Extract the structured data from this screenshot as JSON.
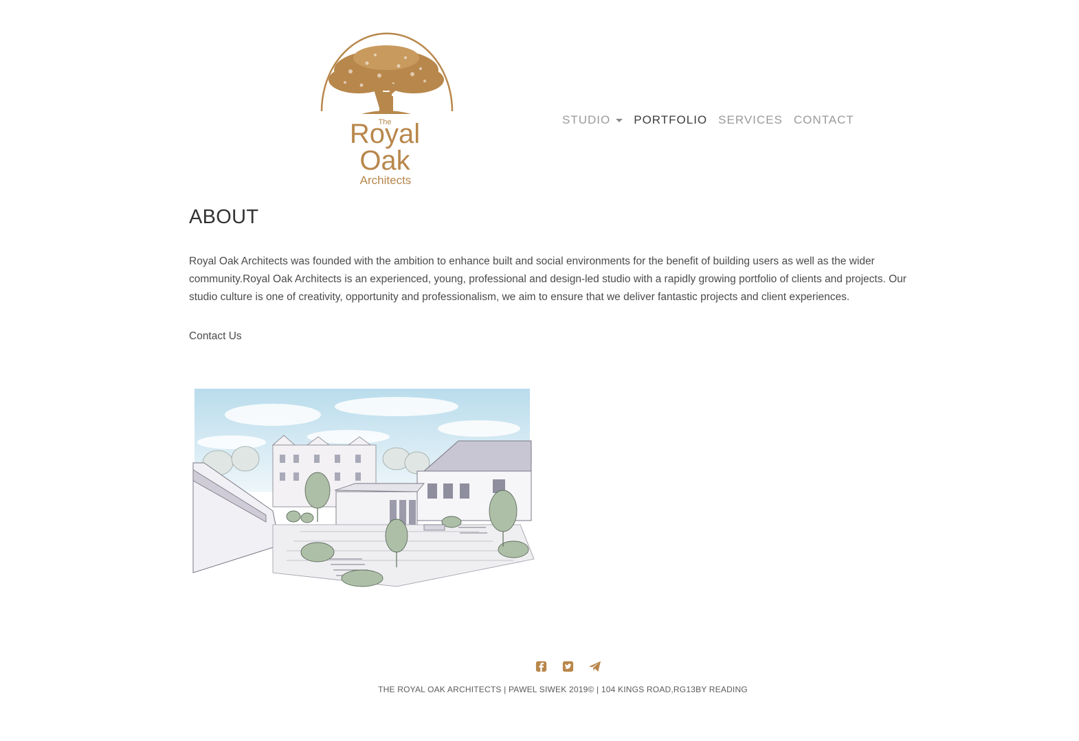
{
  "brand": {
    "logo_small": "The",
    "logo_line1": "Royal",
    "logo_line2": "Oak",
    "logo_line3": "Architects",
    "color": "#B8874B"
  },
  "nav": {
    "items": [
      {
        "label": "STUDIO",
        "has_dropdown": true,
        "active": false
      },
      {
        "label": "PORTFOLIO",
        "has_dropdown": false,
        "active": true
      },
      {
        "label": "SERVICES",
        "has_dropdown": false,
        "active": false
      },
      {
        "label": "CONTACT",
        "has_dropdown": false,
        "active": false
      }
    ]
  },
  "main": {
    "title": "ABOUT",
    "paragraph": "Royal Oak Architects was founded with the ambition to enhance built and social environments for the benefit of building users as well as the wider community.Royal Oak Architects is an experienced, young, professional and design-led studio with a rapidly growing portfolio of clients and projects. Our studio culture is one of creativity, opportunity and professionalism, we aim to ensure that we deliver fantastic projects and client experiences.",
    "contact_link": "Contact Us"
  },
  "footer": {
    "icons": [
      "facebook-icon",
      "twitter-icon",
      "paper-plane-icon"
    ],
    "text": "THE ROYAL OAK ARCHITECTS | PAWEL SIWEK 2019© | 104 KINGS ROAD,RG13BY READING"
  },
  "colors": {
    "accent": "#B8874B",
    "text": "#4a4a4a",
    "nav_inactive": "#9a9a9a",
    "nav_active": "#3c3c3c"
  }
}
